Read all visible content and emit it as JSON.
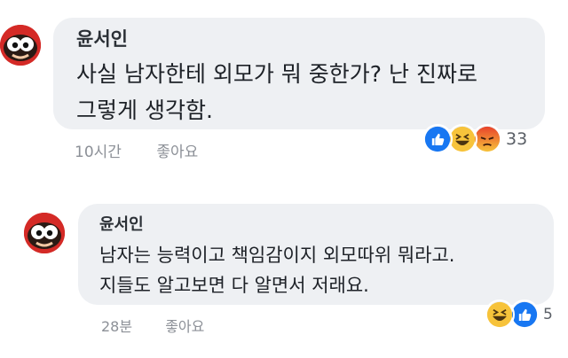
{
  "comments": [
    {
      "author": "윤서인",
      "line1": "사실 남자한테 외모가 뭐 중한가? 난 진짜로",
      "line2": "그렇게 생각함.",
      "time": "10시간",
      "like_label": "좋아요",
      "reaction_count": "33",
      "reactions": [
        "like-icon",
        "haha-icon",
        "angry-icon"
      ]
    },
    {
      "author": "윤서인",
      "line1": "남자는 능력이고 책임감이지 외모따위 뭐라고.",
      "line2": "지들도 알고보면 다 알면서 저래요.",
      "time": "28분",
      "like_label": "좋아요",
      "reaction_count": "5",
      "reactions": [
        "haha-icon",
        "like-icon"
      ]
    }
  ],
  "colors": {
    "bubble": "#eef0f3",
    "like": "#1877f2",
    "haha": "#f7c33b",
    "angry": "#e8432b"
  }
}
